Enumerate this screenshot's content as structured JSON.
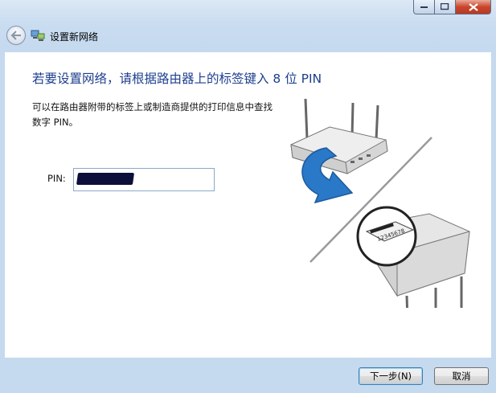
{
  "window": {
    "title": "设置新网络",
    "controls": {
      "minimize_icon": "minimize-icon",
      "maximize_icon": "maximize-icon",
      "close_icon": "close-icon"
    }
  },
  "main": {
    "heading": "若要设置网络，请根据路由器上的标签键入 8 位 PIN",
    "description": "可以在路由器附带的标签上或制造商提供的打印信息中查找数字 PIN。",
    "pin_label": "PIN:",
    "label_serial": "12345678"
  },
  "buttons": {
    "next": "下一步(N)",
    "cancel": "取消"
  },
  "colors": {
    "heading": "#1e3f8e",
    "frame": "#c5d9ef",
    "arrow": "#2a78c8"
  }
}
